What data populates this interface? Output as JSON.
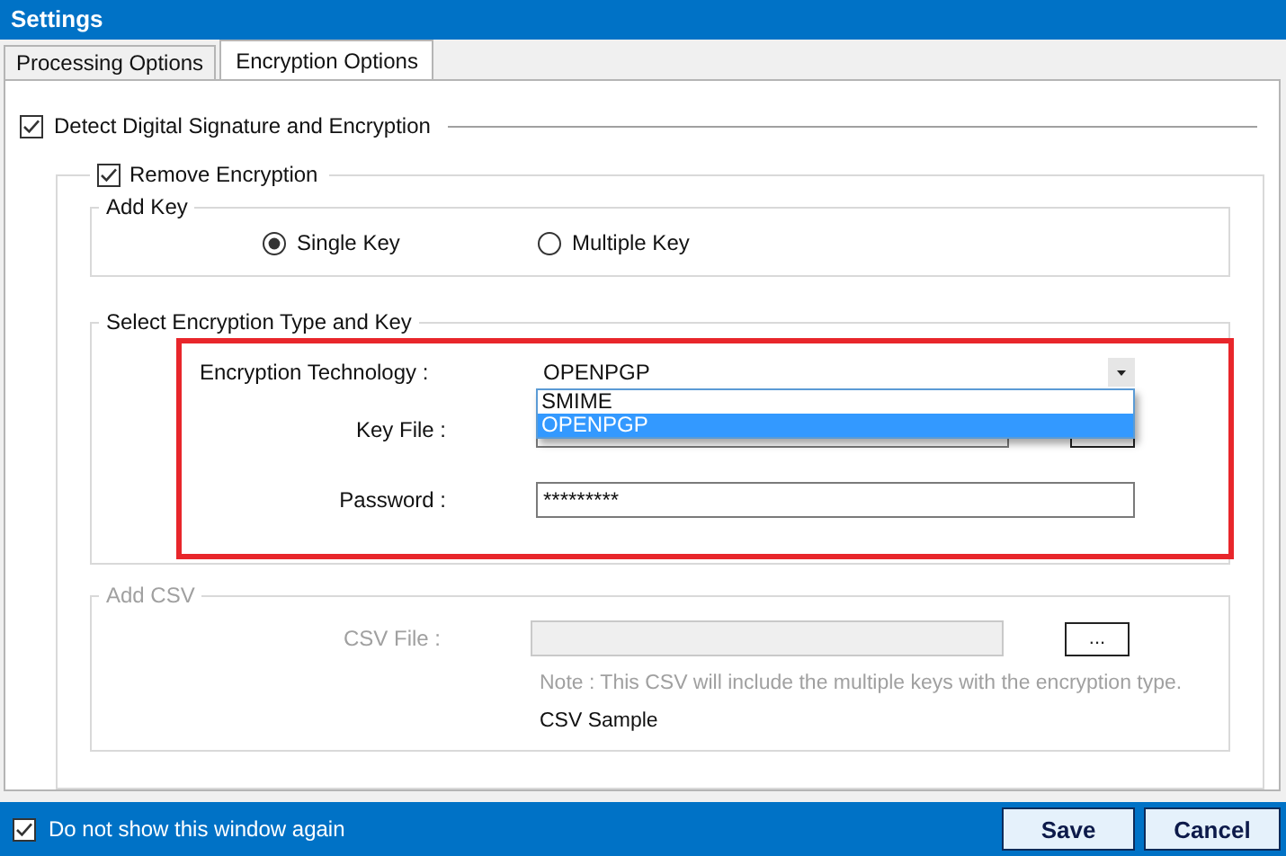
{
  "window": {
    "title": "Settings"
  },
  "tabs": [
    {
      "label": "Processing Options",
      "selected": false
    },
    {
      "label": "Encryption Options",
      "selected": true
    }
  ],
  "detect": {
    "label": "Detect Digital Signature and Encryption",
    "checked": true
  },
  "remove": {
    "label": "Remove Encryption",
    "checked": true
  },
  "add_key": {
    "title": "Add Key",
    "options": [
      {
        "label": "Single Key",
        "selected": true
      },
      {
        "label": "Multiple Key",
        "selected": false
      }
    ]
  },
  "encryption": {
    "title": "Select Encryption Type and Key",
    "technology": {
      "label": "Encryption Technology :",
      "value": "OPENPGP",
      "expanded": true,
      "options": [
        {
          "label": "SMIME",
          "selected": false
        },
        {
          "label": "OPENPGP",
          "selected": true
        }
      ]
    },
    "key_file": {
      "label": "Key File  :"
    },
    "password": {
      "label": "Password :",
      "value": "*********"
    }
  },
  "csv": {
    "title": "Add CSV",
    "disabled": true,
    "file_label": "CSV File :",
    "browse": "...",
    "note": "Note : This CSV will include the multiple keys with the encryption type.",
    "sample": "CSV Sample"
  },
  "footer": {
    "dont_show": {
      "label": "Do not show this window again",
      "checked": true
    },
    "buttons": [
      "Save",
      "Cancel"
    ]
  }
}
